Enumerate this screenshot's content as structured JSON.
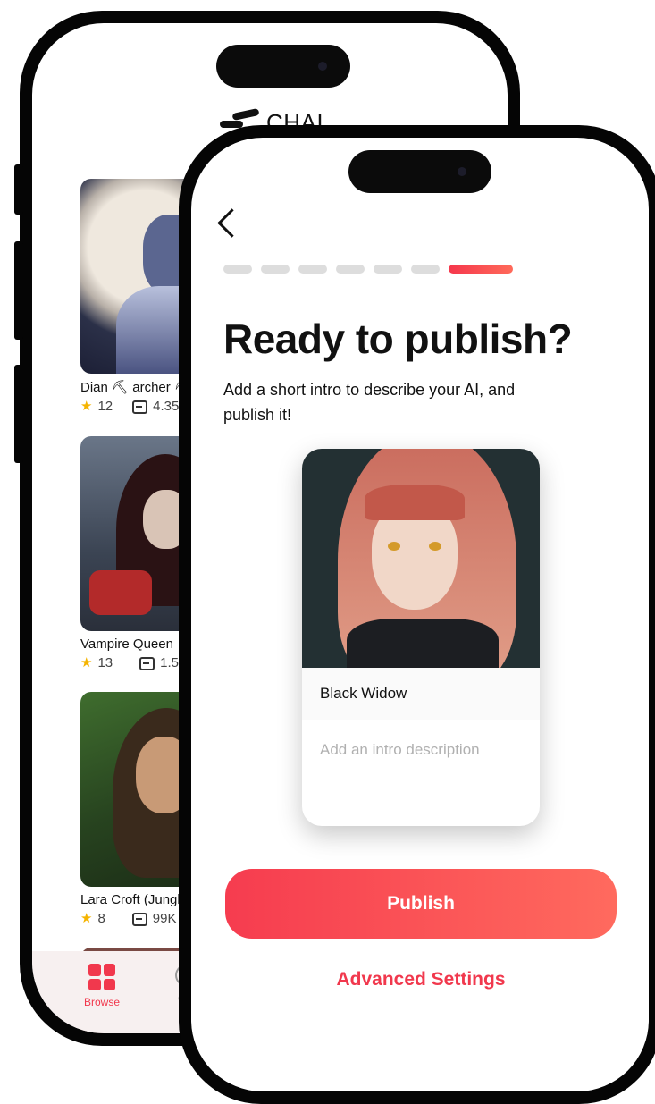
{
  "brand": {
    "name": "CHAI"
  },
  "feed": {
    "cards": [
      {
        "name": "Dian ⛏ archer ⛏ (I",
        "stars": "12",
        "chats": "4.35K"
      },
      {
        "name": "Vampire Queen",
        "stars": "13",
        "chats": "1.5M"
      },
      {
        "name": "Lara Croft (Jungle A",
        "stars": "8",
        "chats": "99K"
      }
    ]
  },
  "bottom_nav": {
    "browse_label": "Browse",
    "chat_label": "Cha"
  },
  "publish_screen": {
    "title": "Ready to publish?",
    "subtitle": "Add a short intro to describe your AI, and publish it!",
    "progress": {
      "total_steps": 7,
      "current_step": 7
    },
    "card": {
      "name": "Black Widow",
      "intro_placeholder": "Add an intro description"
    },
    "publish_label": "Publish",
    "advanced_label": "Advanced Settings"
  },
  "colors": {
    "accent": "#f1384d",
    "accent_end": "#ff6a5e",
    "star": "#f5b400"
  }
}
